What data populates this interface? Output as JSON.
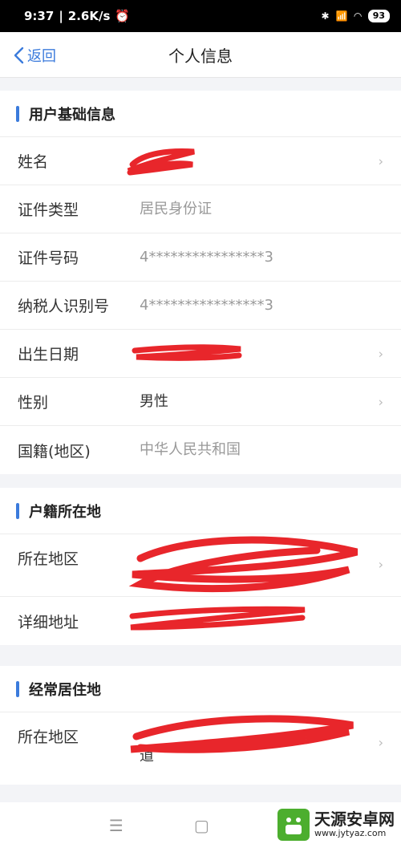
{
  "status_bar": {
    "time": "9:37",
    "speed": "2.6K/s",
    "network": "4G",
    "battery": "93"
  },
  "nav": {
    "back_label": "返回",
    "title": "个人信息"
  },
  "sections": {
    "basic": {
      "title": "用户基础信息",
      "rows": [
        {
          "label": "姓名",
          "value": "",
          "has_arrow": true
        },
        {
          "label": "证件类型",
          "value": "居民身份证",
          "has_arrow": false
        },
        {
          "label": "证件号码",
          "value": "4****************3",
          "has_arrow": false
        },
        {
          "label": "纳税人识别号",
          "value": "4****************3",
          "has_arrow": false
        },
        {
          "label": "出生日期",
          "value": "",
          "has_arrow": true
        },
        {
          "label": "性别",
          "value": "男性",
          "has_arrow": true
        },
        {
          "label": "国籍(地区)",
          "value": "中华人民共和国",
          "has_arrow": false
        }
      ]
    },
    "household": {
      "title": "户籍所在地",
      "rows": [
        {
          "label": "所在地区",
          "value": "",
          "has_arrow": true
        },
        {
          "label": "详细地址",
          "value": "",
          "has_arrow": false
        }
      ]
    },
    "residence": {
      "title": "经常居住地",
      "rows": [
        {
          "label": "所在地区",
          "value": "道",
          "has_arrow": true
        }
      ]
    }
  },
  "watermark": {
    "name": "天源安卓网",
    "url": "www.jytyaz.com"
  },
  "colors": {
    "accent": "#3b7bdc",
    "redaction": "#e8262b"
  }
}
